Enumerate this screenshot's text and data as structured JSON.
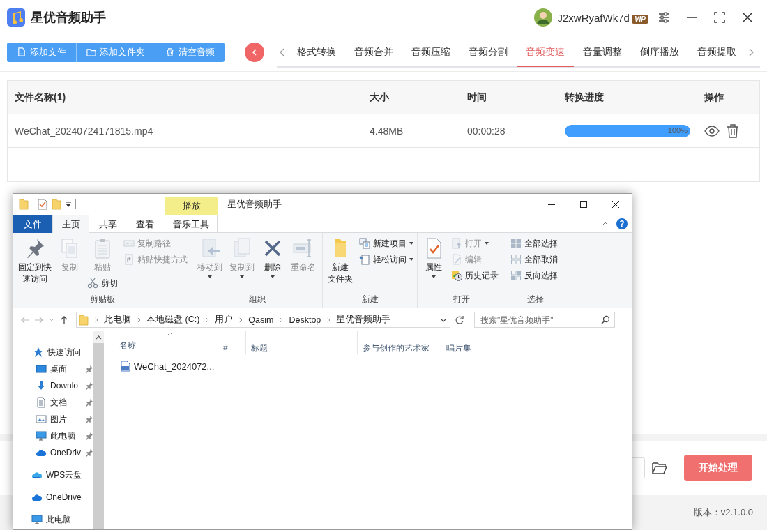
{
  "app": {
    "title": "星优音频助手",
    "user": "J2xwRyafWk7d",
    "badge": "VIP",
    "toolbar": [
      "添加文件",
      "添加文件夹",
      "清空音频"
    ],
    "tabs": [
      {
        "label": "格式转换",
        "selected": false
      },
      {
        "label": "音频合并",
        "selected": false
      },
      {
        "label": "音频压缩",
        "selected": false
      },
      {
        "label": "音频分割",
        "selected": false
      },
      {
        "label": "音频变速",
        "selected": true
      },
      {
        "label": "音量调整",
        "selected": false
      },
      {
        "label": "倒序播放",
        "selected": false
      },
      {
        "label": "音频提取",
        "selected": false
      }
    ],
    "table": {
      "columns": [
        "文件名称(1)",
        "大小",
        "时间",
        "转换进度",
        "操作"
      ],
      "rows": [
        {
          "name": "WeChat_20240724171815.mp4",
          "size": "4.48MB",
          "duration": "00:00:28",
          "level": 1,
          "reading": "100%"
        }
      ]
    },
    "start_button": "开始处理",
    "version": "版本：v2.1.0.0"
  },
  "explorer": {
    "context_tab": "播放",
    "title": "星优音频助手",
    "help": "?",
    "ribbon_tabs": [
      {
        "label": "文件",
        "kind": "file",
        "selected": false
      },
      {
        "label": "主页",
        "kind": "tab",
        "selected": true
      },
      {
        "label": "共享",
        "kind": "tab",
        "selected": false
      },
      {
        "label": "查看",
        "kind": "tab",
        "selected": false
      },
      {
        "label": "音乐工具",
        "kind": "context",
        "selected": false
      }
    ],
    "groups": [
      {
        "label": "剪贴板",
        "columns": [
          [
            {
              "lines": [
                "固定到快",
                "速访问"
              ],
              "kind": "large",
              "disabled": false,
              "dropdown": false
            }
          ],
          [
            {
              "lines": [
                "复制"
              ],
              "kind": "large",
              "disabled": true,
              "dropdown": false
            }
          ],
          [
            {
              "lines": [
                "粘贴"
              ],
              "kind": "large",
              "disabled": true,
              "dropdown": false
            },
            {
              "label": "剪切",
              "kind": "small",
              "disabled": false,
              "dropdown": false
            }
          ],
          [
            {
              "label": "复制路径",
              "kind": "small",
              "disabled": true,
              "dropdown": false
            },
            {
              "label": "粘贴快捷方式",
              "kind": "small",
              "disabled": true,
              "dropdown": false
            }
          ]
        ]
      },
      {
        "label": "组织",
        "columns": [
          [
            {
              "lines": [
                "移动到"
              ],
              "kind": "large",
              "disabled": true,
              "dropdown": true
            }
          ],
          [
            {
              "lines": [
                "复制到"
              ],
              "kind": "large",
              "disabled": true,
              "dropdown": true
            }
          ],
          [
            {
              "lines": [
                "删除"
              ],
              "kind": "large",
              "disabled": false,
              "dropdown": true
            }
          ],
          [
            {
              "lines": [
                "重命名"
              ],
              "kind": "large",
              "disabled": true,
              "dropdown": false
            }
          ]
        ]
      },
      {
        "label": "新建",
        "columns": [
          [
            {
              "lines": [
                "新建",
                "文件夹"
              ],
              "kind": "large",
              "disabled": false,
              "dropdown": false
            }
          ],
          [
            {
              "label": "新建项目",
              "kind": "small",
              "disabled": false,
              "dropdown": true
            },
            {
              "label": "轻松访问",
              "kind": "small",
              "disabled": false,
              "dropdown": true
            }
          ]
        ]
      },
      {
        "label": "打开",
        "columns": [
          [
            {
              "lines": [
                "属性"
              ],
              "kind": "large",
              "disabled": false,
              "dropdown": true
            }
          ],
          [
            {
              "label": "打开",
              "kind": "small",
              "disabled": true,
              "dropdown": true
            },
            {
              "label": "编辑",
              "kind": "small",
              "disabled": true,
              "dropdown": false
            },
            {
              "label": "历史记录",
              "kind": "small",
              "disabled": false,
              "dropdown": false
            }
          ]
        ]
      },
      {
        "label": "选择",
        "columns": [
          [
            {
              "label": "全部选择",
              "kind": "small",
              "disabled": false,
              "dropdown": false
            },
            {
              "label": "全部取消",
              "kind": "small",
              "disabled": false,
              "dropdown": false
            },
            {
              "label": "反向选择",
              "kind": "small",
              "disabled": false,
              "dropdown": false
            }
          ]
        ]
      }
    ],
    "path": [
      "此电脑",
      "本地磁盘 (C:)",
      "用户",
      "Qasim",
      "Desktop",
      "星优音频助手"
    ],
    "search": {
      "placeholder": "搜索\"星优音频助手\""
    },
    "nav": [
      {
        "label": "快速访问",
        "kind": "star",
        "pinned": false,
        "children": [
          {
            "label": "桌面",
            "kind": "desktop",
            "pinned": true
          },
          {
            "label": "Downlo",
            "kind": "download",
            "pinned": true
          },
          {
            "label": "文档",
            "kind": "documents",
            "pinned": true
          },
          {
            "label": "图片",
            "kind": "pictures",
            "pinned": true
          },
          {
            "label": "此电脑",
            "kind": "pc",
            "pinned": true
          },
          {
            "label": "OneDriv",
            "kind": "cloud",
            "pinned": true
          }
        ]
      },
      {
        "label": "WPS云盘",
        "kind": "wps",
        "pinned": false
      },
      {
        "label": "OneDrive",
        "kind": "cloud",
        "pinned": false
      },
      {
        "label": "此电脑",
        "kind": "pc",
        "pinned": false
      }
    ],
    "columns": [
      "名称",
      "#",
      "标题",
      "参与创作的艺术家",
      "唱片集"
    ],
    "files": [
      {
        "name": "WeChat_2024072..."
      }
    ]
  }
}
